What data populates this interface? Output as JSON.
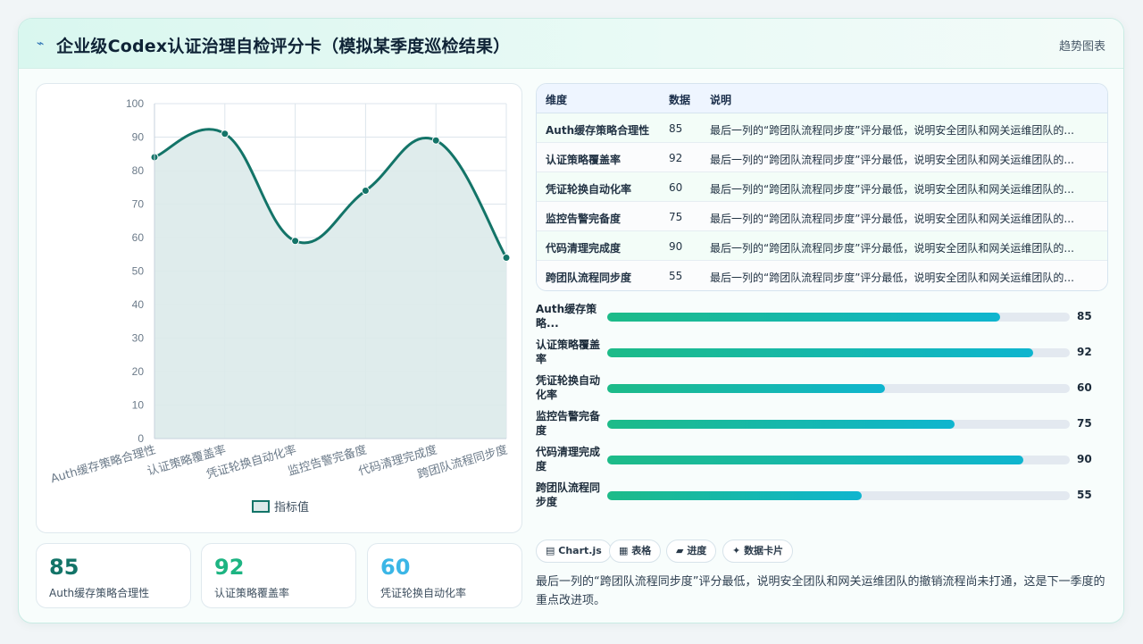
{
  "header": {
    "icon": "bolt-icon",
    "title": "企业级Codex认证治理自检评分卡（模拟某季度巡检结果）",
    "subtitle": "趋势图表"
  },
  "chart_data": {
    "type": "area",
    "categories": [
      "Auth缓存策略合理性",
      "认证策略覆盖率",
      "凭证轮换自动化率",
      "监控告警完备度",
      "代码清理完成度",
      "跨团队流程同步度"
    ],
    "series": [
      {
        "name": "指标值",
        "values": [
          84,
          91,
          59,
          74,
          89,
          54
        ]
      }
    ],
    "ylim": [
      0,
      100
    ],
    "yticks": [
      0,
      10,
      20,
      30,
      40,
      50,
      60,
      70,
      80,
      90,
      100
    ],
    "grid": true,
    "legend": "bottom",
    "colors": {
      "line": "#137468",
      "fill": "#dceaea",
      "grid": "#dde5ec",
      "tick": "#6b7a89"
    }
  },
  "kpis": [
    {
      "value": "85",
      "label": "Auth缓存策略合理性",
      "color": "#137468"
    },
    {
      "value": "92",
      "label": "认证策略覆盖率",
      "color": "#1db482"
    },
    {
      "value": "60",
      "label": "凭证轮换自动化率",
      "color": "#3bb6e6"
    }
  ],
  "table": {
    "headers": [
      "维度",
      "数据",
      "说明"
    ],
    "rows": [
      {
        "dim": "Auth缓存策略合理性",
        "val": "85",
        "desc": "最后一列的“跨团队流程同步度”评分最低，说明安全团队和网关运维团队的..."
      },
      {
        "dim": "认证策略覆盖率",
        "val": "92",
        "desc": "最后一列的“跨团队流程同步度”评分最低，说明安全团队和网关运维团队的..."
      },
      {
        "dim": "凭证轮换自动化率",
        "val": "60",
        "desc": "最后一列的“跨团队流程同步度”评分最低，说明安全团队和网关运维团队的..."
      },
      {
        "dim": "监控告警完备度",
        "val": "75",
        "desc": "最后一列的“跨团队流程同步度”评分最低，说明安全团队和网关运维团队的..."
      },
      {
        "dim": "代码清理完成度",
        "val": "90",
        "desc": "最后一列的“跨团队流程同步度”评分最低，说明安全团队和网关运维团队的..."
      },
      {
        "dim": "跨团队流程同步度",
        "val": "55",
        "desc": "最后一列的“跨团队流程同步度”评分最低，说明安全团队和网关运维团队的..."
      }
    ]
  },
  "progress": [
    {
      "label": "Auth缓存策略...",
      "value": 85
    },
    {
      "label": "认证策略覆盖率",
      "value": 92
    },
    {
      "label": "凭证轮换自动化率",
      "value": 60
    },
    {
      "label": "监控告警完备度",
      "value": 75
    },
    {
      "label": "代码清理完成度",
      "value": 90
    },
    {
      "label": "跨团队流程同步度",
      "value": 55
    }
  ],
  "tags": [
    {
      "icon": "chart-icon",
      "glyph": "▤",
      "label": "Chart.js"
    },
    {
      "icon": "table-icon",
      "glyph": "▦",
      "label": "表格"
    },
    {
      "icon": "progress-icon",
      "glyph": "▰",
      "label": "进度"
    },
    {
      "icon": "sparkle-icon",
      "glyph": "✦",
      "label": "数据卡片"
    }
  ],
  "note": "最后一列的“跨团队流程同步度”评分最低，说明安全团队和网关运维团队的撤销流程尚未打通，这是下一季度的重点改进项。"
}
